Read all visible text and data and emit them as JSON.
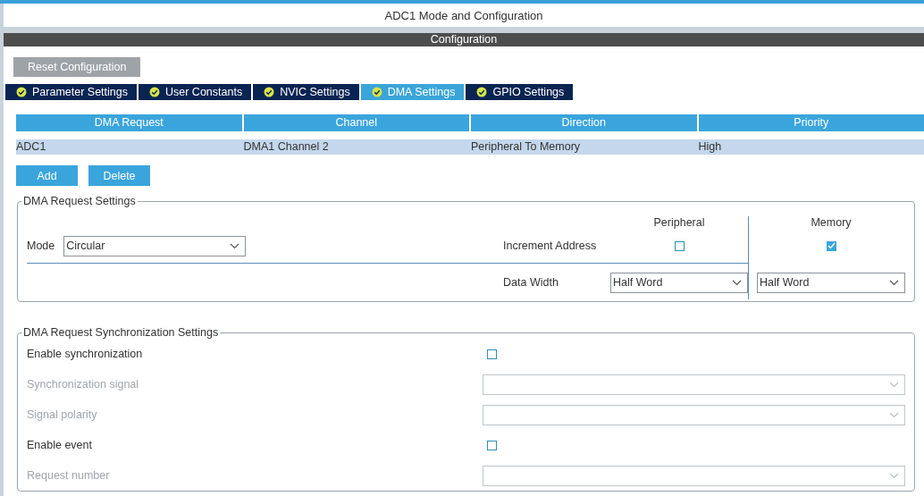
{
  "window": {
    "title": "ADC1 Mode and Configuration"
  },
  "section_title": "Configuration",
  "reset_button": "Reset Configuration",
  "tabs": [
    {
      "label": "Parameter Settings",
      "selected": false,
      "ok": true
    },
    {
      "label": "User Constants",
      "selected": false,
      "ok": true
    },
    {
      "label": "NVIC Settings",
      "selected": false,
      "ok": true
    },
    {
      "label": "DMA Settings",
      "selected": true,
      "ok": true
    },
    {
      "label": "GPIO Settings",
      "selected": false,
      "ok": true
    }
  ],
  "table": {
    "columns": [
      "DMA Request",
      "Channel",
      "Direction",
      "Priority"
    ],
    "rows": [
      {
        "cells": [
          "ADC1",
          "DMA1 Channel 2",
          "Peripheral To Memory",
          "High"
        ],
        "selected": true
      }
    ]
  },
  "buttons": [
    "Add",
    "Delete"
  ],
  "request_settings": {
    "title": "DMA Request Settings",
    "mode_label": "Mode",
    "mode_value": "Circular",
    "peripheral_heading": "Peripheral",
    "memory_heading": "Memory",
    "increment_label": "Increment Address",
    "peripheral_increment": false,
    "memory_increment": true,
    "data_width_label": "Data Width",
    "peripheral_width": "Half Word",
    "memory_width": "Half Word"
  },
  "sync_settings": {
    "title": "DMA Request Synchronization Settings",
    "rows": [
      {
        "kind": "check",
        "label": "Enable synchronization",
        "checked": false,
        "disabled": false
      },
      {
        "kind": "select",
        "label": "Synchronization signal",
        "disabled": true
      },
      {
        "kind": "select",
        "label": "Signal polarity",
        "disabled": true
      },
      {
        "kind": "check",
        "label": "Enable event",
        "checked": false,
        "disabled": false
      },
      {
        "kind": "select",
        "label": "Request number",
        "disabled": true
      }
    ]
  }
}
